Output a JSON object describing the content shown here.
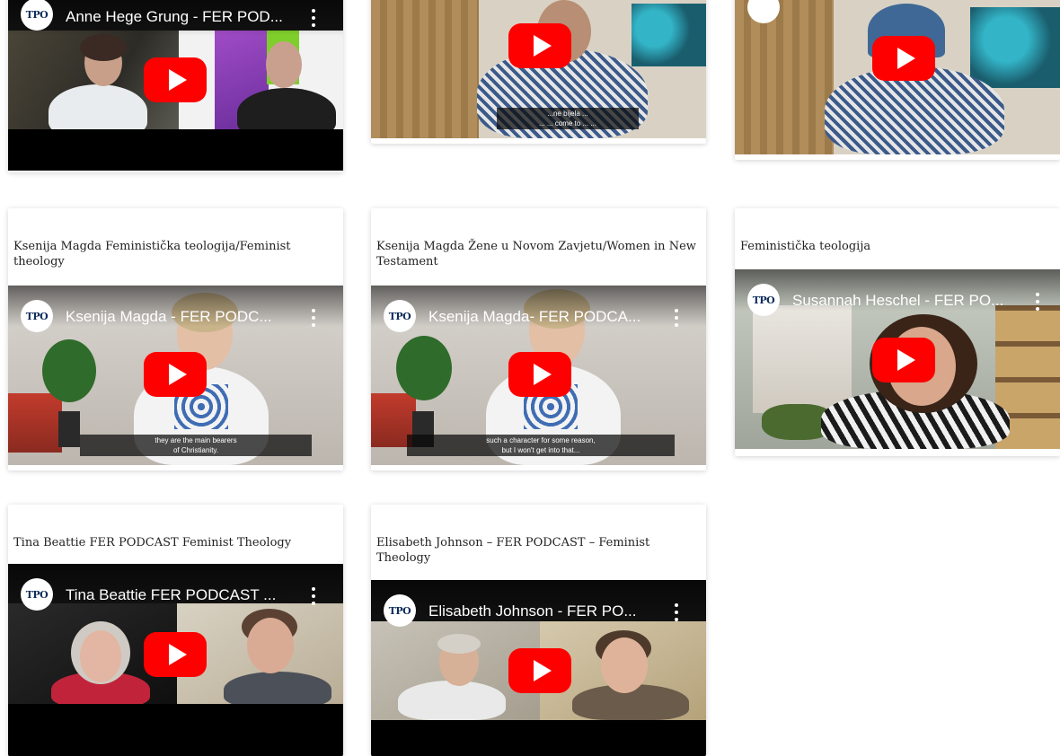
{
  "row1": {
    "video1": {
      "title": "Anne Hege Grung - FER POD...",
      "logo": "TPO"
    },
    "video2": {
      "caption_line1": "...ne bijela ...",
      "caption_line2": "... ... come to ... ..."
    }
  },
  "row2": {
    "card1": {
      "heading": "Ksenija Magda Feministička teologija/Feminist theology",
      "video_title": "Ksenija Magda - FER PODC...",
      "caption_line1": "they are the main bearers",
      "caption_line2": "of Christianity.",
      "logo": "TPO"
    },
    "card2": {
      "heading": "Ksenija Magda Žene u Novom Zavjetu/Women in New Testament",
      "video_title": "Ksenija Magda- FER PODCA...",
      "caption_line1": "such a character for some reason,",
      "caption_line2": "but I won't get into that...",
      "logo": "TPO"
    },
    "card3": {
      "heading": "Feministička teologija",
      "video_title": "Susannah Heschel - FER PO...",
      "logo": "TPO"
    }
  },
  "row3": {
    "card1": {
      "heading": "Tina Beattie FER PODCAST Feminist Theology",
      "video_title": "Tina Beattie FER PODCAST ...",
      "logo": "TPO"
    },
    "card2": {
      "heading": "Elisabeth Johnson – FER PODCAST – Feminist Theology",
      "video_title": "Elisabeth Johnson - FER PO...",
      "logo": "TPO"
    }
  },
  "colors": {
    "play": "#ff0000",
    "card_bg": "#ffffff",
    "title_text": "#222222"
  },
  "icons": [
    "play-button-icon",
    "more-vert-icon",
    "channel-logo-icon"
  ]
}
